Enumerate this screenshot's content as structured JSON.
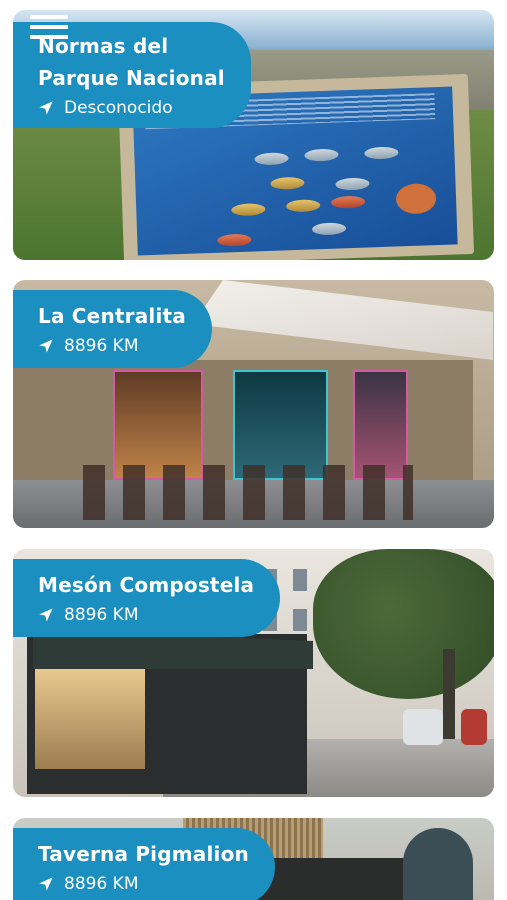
{
  "header": {
    "menu_icon": "hamburger-menu-icon"
  },
  "colors": {
    "label_bg": "#1b8fbf",
    "label_text": "#ffffff"
  },
  "places": [
    {
      "name_line1": "Normas del",
      "name_line2": "Parque Nacional",
      "distance": "Desconocido",
      "icon": "navigation-arrow-icon"
    },
    {
      "name": "La Centralita",
      "distance": "8896 KM",
      "icon": "navigation-arrow-icon"
    },
    {
      "name": "Mesón Compostela",
      "distance": "8896 KM",
      "icon": "navigation-arrow-icon"
    },
    {
      "name": "Taverna Pigmalion",
      "distance": "8896 KM",
      "icon": "navigation-arrow-icon"
    }
  ]
}
